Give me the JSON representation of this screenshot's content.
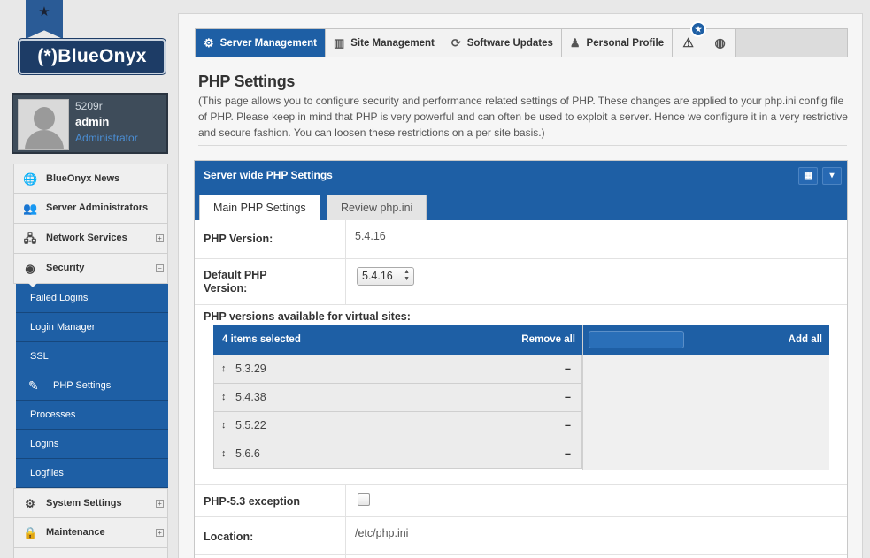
{
  "brand": {
    "logo_text": "(*)BlueOnyx",
    "ribbon_icon": "star-icon"
  },
  "profile": {
    "host": "5209r",
    "user": "admin",
    "role": "Administrator"
  },
  "sidebar": {
    "items": [
      {
        "label": "BlueOnyx News",
        "icon": "globe-icon",
        "glyph": "🌐"
      },
      {
        "label": "Server Administrators",
        "icon": "users-icon",
        "glyph": "👥"
      },
      {
        "label": "Network Services",
        "icon": "network-icon",
        "glyph": "🖧",
        "expand": "+"
      },
      {
        "label": "Security",
        "icon": "eye-icon",
        "glyph": "◉",
        "expand": "−"
      }
    ],
    "security_sub": [
      {
        "label": "Failed Logins"
      },
      {
        "label": "Login Manager"
      },
      {
        "label": "SSL"
      },
      {
        "label": "PHP Settings",
        "icon": "pencil-icon"
      },
      {
        "label": "Processes"
      },
      {
        "label": "Logins"
      },
      {
        "label": "Logfiles"
      }
    ],
    "items_after": [
      {
        "label": "System Settings",
        "icon": "gear-icon",
        "glyph": "⚙",
        "expand": "+"
      },
      {
        "label": "Maintenance",
        "icon": "lock-icon",
        "glyph": "🔒",
        "expand": "+"
      }
    ]
  },
  "topnav": {
    "tabs": [
      {
        "label": "Server Management",
        "icon": "gear-icon",
        "glyph": "⚙"
      },
      {
        "label": "Site Management",
        "icon": "columns-icon",
        "glyph": "▥"
      },
      {
        "label": "Software Updates",
        "icon": "refresh-icon",
        "glyph": "⟳"
      },
      {
        "label": "Personal Profile",
        "icon": "person-icon",
        "glyph": "♟"
      }
    ],
    "alert_icon": "warning-icon",
    "badge_icon": "star-icon",
    "help_icon": "lifebuoy-icon"
  },
  "page": {
    "title": "PHP Settings",
    "description": "(This page allows you to configure security and performance related settings of PHP. These changes are applied to your php.ini config file of PHP. Please keep in mind that PHP is very powerful and can often be used to exploit a server. Hence we configure it in a very restrictive and secure fashion. You can loosen these restrictions on a per site basis.)"
  },
  "panel": {
    "title": "Server wide PHP Settings",
    "tabs": {
      "main": "Main PHP Settings",
      "review": "Review php.ini"
    },
    "php_version_label": "PHP Version:",
    "php_version_value": "5.4.16",
    "default_php_label_line1": "Default PHP",
    "default_php_label_line2": "Version:",
    "default_php_value": "5.4.16",
    "available_label": "PHP versions available for virtual sites:",
    "multiselect": {
      "selected_count": "4 items selected",
      "remove_all": "Remove all",
      "add_all": "Add all",
      "options": [
        "5.3.29",
        "5.4.38",
        "5.5.22",
        "5.6.6"
      ]
    },
    "exception_label": "PHP-5.3 exception",
    "location_label": "Location:",
    "location_value": "/etc/php.ini"
  }
}
